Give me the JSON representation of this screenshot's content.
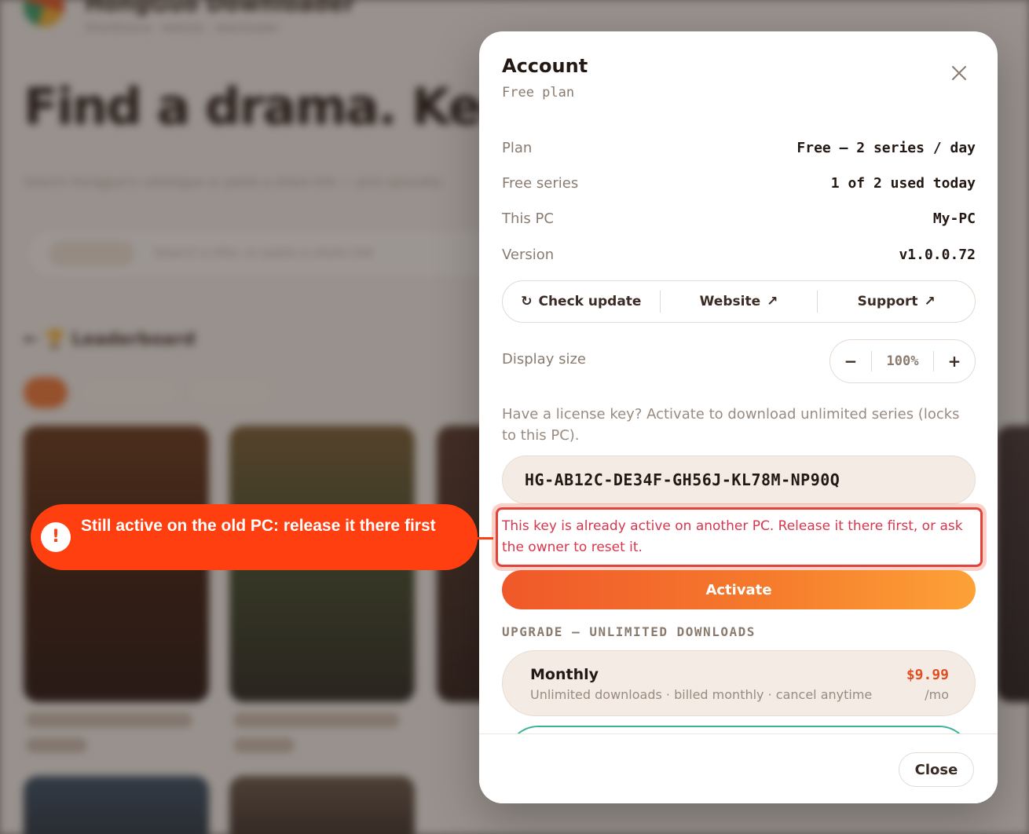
{
  "modal": {
    "title": "Account",
    "subtitle": "Free plan",
    "rows": [
      {
        "label": "Plan",
        "value": "Free — 2 series / day"
      },
      {
        "label": "Free series",
        "value": "1 of 2 used today"
      },
      {
        "label": "This PC",
        "value": "My-PC"
      },
      {
        "label": "Version",
        "value": "v1.0.0.72"
      }
    ],
    "actions": {
      "check_update": "Check update",
      "website": "Website",
      "support": "Support"
    },
    "display_size": {
      "label": "Display size",
      "value": "100%",
      "minus": "−",
      "plus": "+"
    },
    "license": {
      "help": "Have a license key? Activate to download unlimited series (locks to this PC).",
      "value": "HG-AB12C-DE34F-GH56J-KL78M-NP90Q",
      "error": "This key is already active on another PC. Release it there first, or ask the owner to reset it."
    },
    "activate_label": "Activate",
    "upgrade": {
      "header": "UPGRADE — UNLIMITED DOWNLOADS",
      "plans": [
        {
          "name": "Monthly",
          "desc": "Unlimited downloads · billed monthly · cancel anytime",
          "price": "$9.99",
          "per": "/mo"
        }
      ]
    },
    "close_label": "Close"
  },
  "callout": {
    "text": "Still active on the old PC: release it there first",
    "icon": "!"
  },
  "colors": {
    "accent": "#ff3f0f",
    "error": "#d7364d",
    "price": "#e04f23"
  }
}
